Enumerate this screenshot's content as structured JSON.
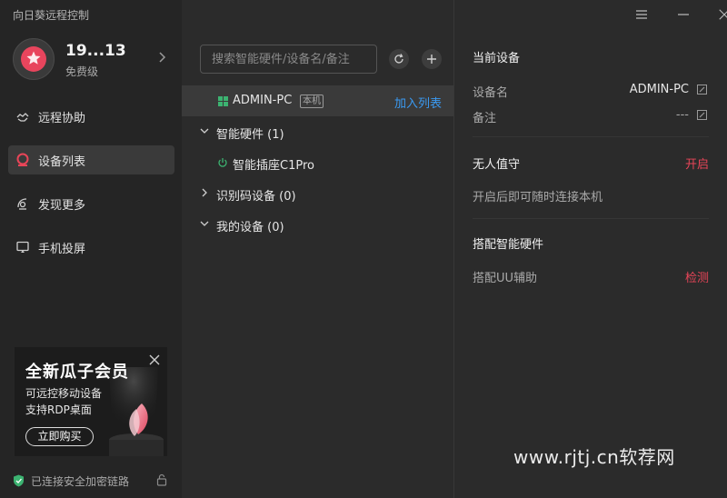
{
  "app": {
    "title": "向日葵远程控制"
  },
  "profile": {
    "name": "19...13",
    "level": "免费级"
  },
  "nav": [
    {
      "label": "远程协助",
      "icon": "remote-assist-icon"
    },
    {
      "label": "设备列表",
      "icon": "device-list-icon",
      "active": true
    },
    {
      "label": "发现更多",
      "icon": "discover-icon"
    },
    {
      "label": "手机投屏",
      "icon": "screen-mirror-icon"
    }
  ],
  "promo": {
    "title": "全新瓜子会员",
    "line1": "可远控移动设备",
    "line2": "支持RDP桌面",
    "button": "立即购买"
  },
  "status": {
    "text": "已连接安全加密链路"
  },
  "search": {
    "placeholder": "搜索智能硬件/设备名/备注"
  },
  "tree": {
    "current_device": "ADMIN-PC",
    "local_badge": "本机",
    "add_link": "加入列表",
    "groups": [
      {
        "label": "智能硬件 (1)",
        "expanded": true
      },
      {
        "label": "识别码设备 (0)",
        "expanded": false
      },
      {
        "label": "我的设备 (0)",
        "expanded": true
      }
    ],
    "smart_item": "智能插座C1Pro"
  },
  "details": {
    "current_title": "当前设备",
    "name_label": "设备名",
    "name_value": "ADMIN-PC",
    "note_label": "备注",
    "note_value": "---",
    "unattended_title": "无人值守",
    "unattended_action": "开启",
    "unattended_desc": "开启后即可随时连接本机",
    "pair_title": "搭配智能硬件",
    "pair_label": "搭配UU辅助",
    "pair_action": "检测"
  },
  "watermark": "www.rjtj.cn软荐网",
  "colors": {
    "accent": "#e84558",
    "link": "#3a9af2",
    "sidebar_bg": "#252525",
    "panel_bg": "#2b2b2b"
  }
}
